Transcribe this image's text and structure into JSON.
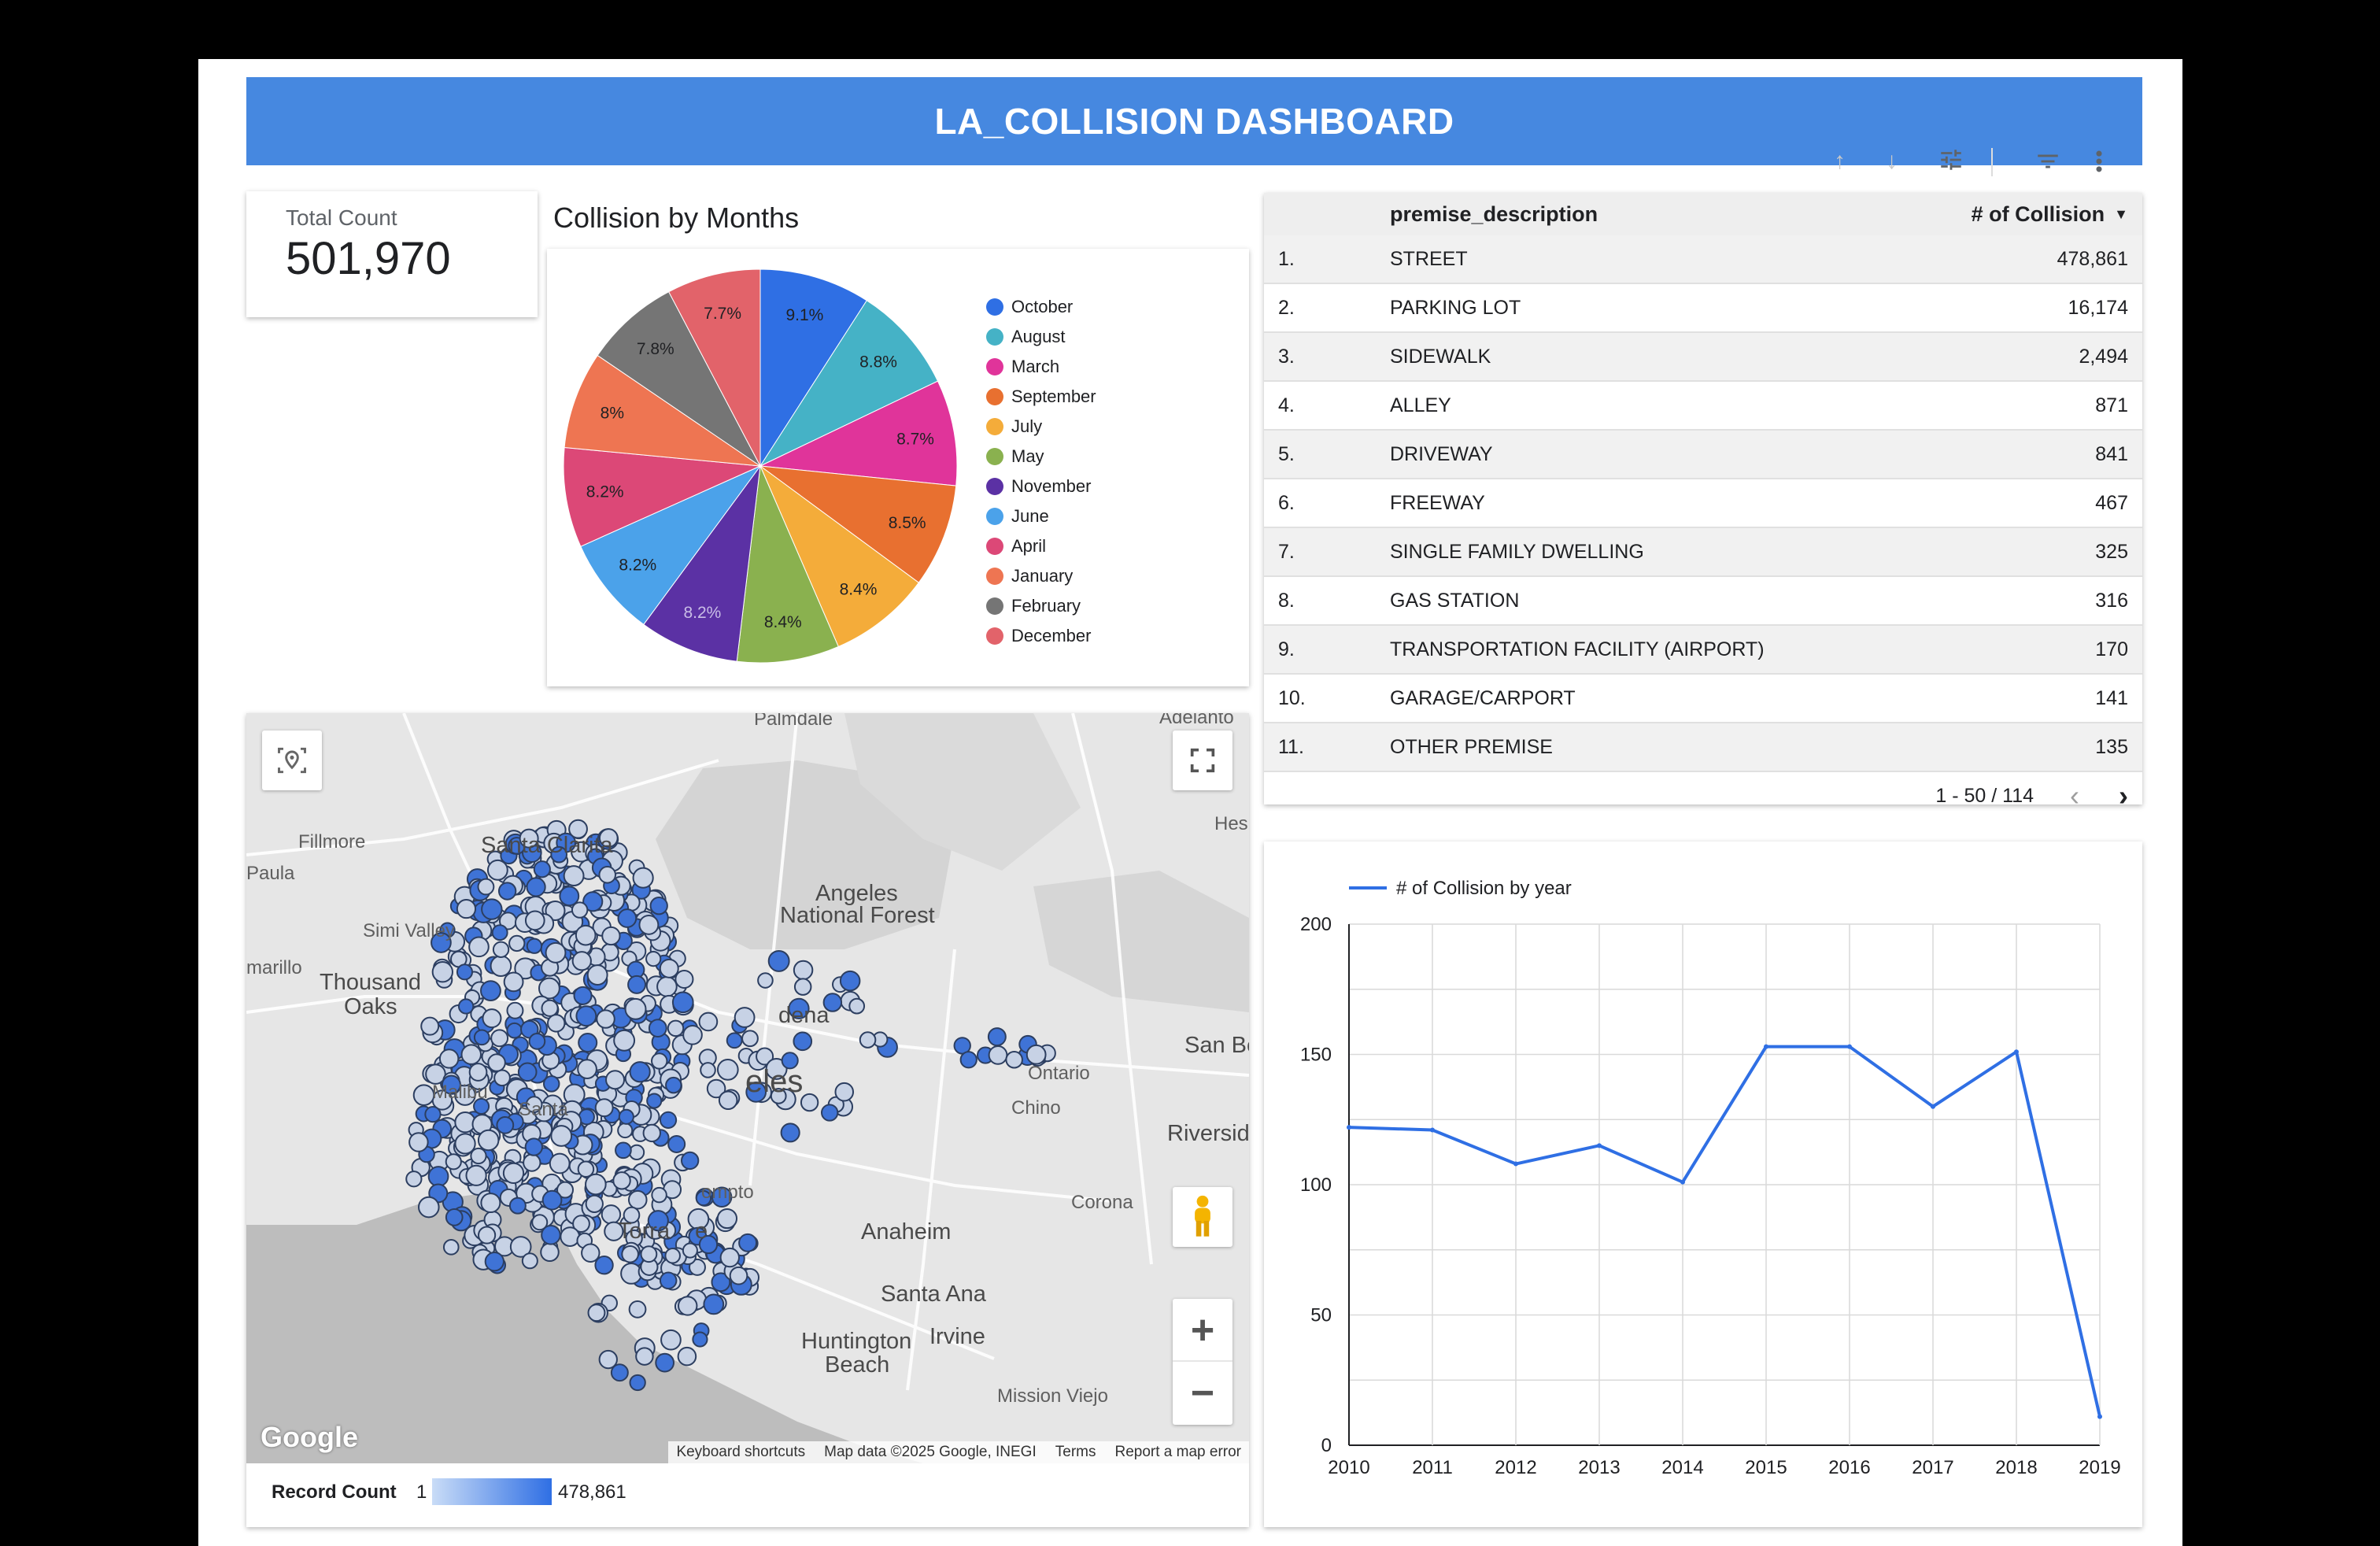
{
  "header": {
    "title": "LA_COLLISION DASHBOARD"
  },
  "scorecard": {
    "label": "Total Count",
    "value": "501,970"
  },
  "pie": {
    "title": "Collision by Months",
    "slices": [
      {
        "name": "October",
        "pct": 9.1,
        "label": "9.1%",
        "color": "#2f6fe4"
      },
      {
        "name": "August",
        "pct": 8.8,
        "label": "8.8%",
        "color": "#45b2c6"
      },
      {
        "name": "March",
        "pct": 8.7,
        "label": "8.7%",
        "color": "#e0349a"
      },
      {
        "name": "September",
        "pct": 8.5,
        "label": "8.5%",
        "color": "#e87030"
      },
      {
        "name": "July",
        "pct": 8.4,
        "label": "8.4%",
        "color": "#f4ac3a"
      },
      {
        "name": "May",
        "pct": 8.4,
        "label": "8.4%",
        "color": "#8ab14f"
      },
      {
        "name": "November",
        "pct": 8.2,
        "label": "8.2%",
        "color": "#5b31a4"
      },
      {
        "name": "June",
        "pct": 8.2,
        "label": "8.2%",
        "color": "#4ba2ea"
      },
      {
        "name": "April",
        "pct": 8.2,
        "label": "8.2%",
        "color": "#dc4877"
      },
      {
        "name": "January",
        "pct": 8.0,
        "label": "8%",
        "color": "#ee7552"
      },
      {
        "name": "February",
        "pct": 7.8,
        "label": "7.8%",
        "color": "#757575"
      },
      {
        "name": "December",
        "pct": 7.7,
        "label": "7.7%",
        "color": "#e2636a"
      }
    ]
  },
  "table": {
    "col_desc": "premise_description",
    "col_val": "# of Collision",
    "rows": [
      {
        "n": "1.",
        "desc": "STREET",
        "val": "478,861"
      },
      {
        "n": "2.",
        "desc": "PARKING LOT",
        "val": "16,174"
      },
      {
        "n": "3.",
        "desc": "SIDEWALK",
        "val": "2,494"
      },
      {
        "n": "4.",
        "desc": "ALLEY",
        "val": "871"
      },
      {
        "n": "5.",
        "desc": "DRIVEWAY",
        "val": "841"
      },
      {
        "n": "6.",
        "desc": "FREEWAY",
        "val": "467"
      },
      {
        "n": "7.",
        "desc": "SINGLE FAMILY DWELLING",
        "val": "325"
      },
      {
        "n": "8.",
        "desc": "GAS STATION",
        "val": "316"
      },
      {
        "n": "9.",
        "desc": "TRANSPORTATION FACILITY (AIRPORT)",
        "val": "170"
      },
      {
        "n": "10.",
        "desc": "GARAGE/CARPORT",
        "val": "141"
      },
      {
        "n": "11.",
        "desc": "OTHER PREMISE",
        "val": "135"
      }
    ],
    "pagination": "1 - 50 / 114"
  },
  "map": {
    "labels": [
      "Palmdale",
      "Adelanto",
      "Fillmore",
      "Santa Clarita",
      "Paula",
      "Angeles",
      "National Forest",
      "Hesp",
      "Simi Valley",
      "marillo",
      "Thousand",
      "Oaks",
      "dena",
      "San Be",
      "Malibu",
      "Santa",
      "eles",
      "Ontario",
      "Chino",
      "Riversid",
      "ompto",
      "Corona",
      "Torra",
      "e",
      "Anaheim",
      "Santa Ana",
      "Huntington",
      "Beach",
      "Irvine",
      "Mission Viejo"
    ],
    "google": "Google",
    "attribution": [
      "Keyboard shortcuts",
      "Map data ©2025 Google, INEGI",
      "Terms",
      "Report a map error"
    ],
    "legend_label": "Record Count",
    "legend_min": "1",
    "legend_max": "478,861"
  },
  "chart_data": {
    "type": "line",
    "title": "",
    "legend": "# of Collision by year",
    "x": [
      "2010",
      "2011",
      "2012",
      "2013",
      "2014",
      "2015",
      "2016",
      "2017",
      "2018",
      "2019"
    ],
    "series": [
      {
        "name": "# of Collision by year",
        "values": [
          122,
          121,
          108,
          115,
          101,
          153,
          153,
          130,
          151,
          11
        ],
        "color": "#2f6fe4"
      }
    ],
    "ylim": [
      0,
      200
    ],
    "yticks": [
      0,
      50,
      100,
      150,
      200
    ],
    "grid": true,
    "legend_position": "top-left"
  }
}
